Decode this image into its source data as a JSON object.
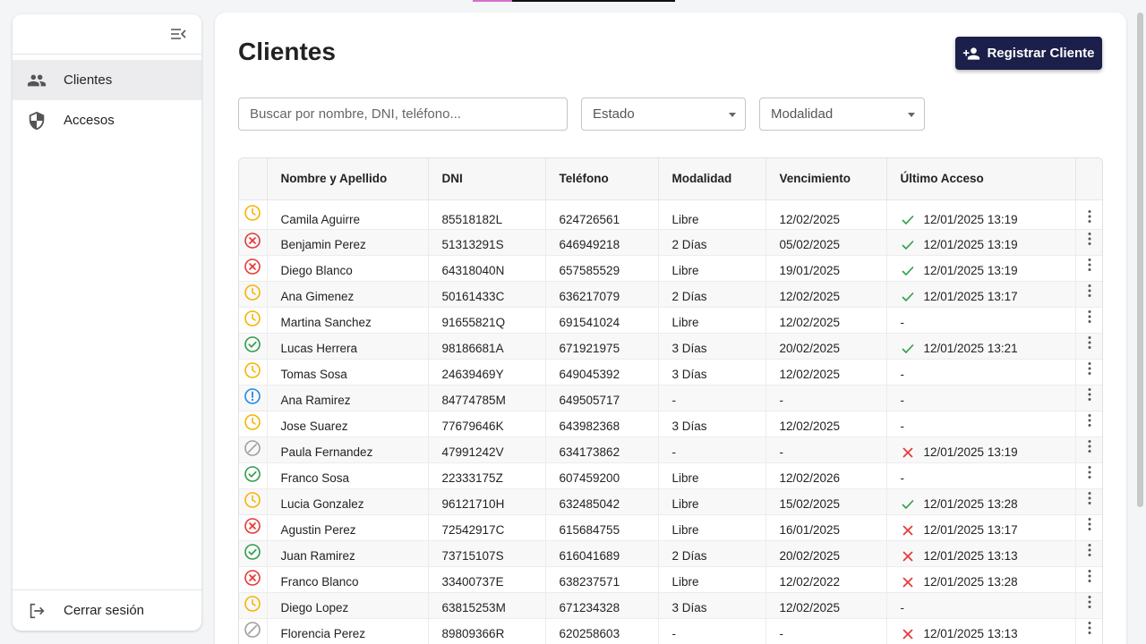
{
  "sidebar": {
    "items": [
      {
        "label": "Clientes",
        "icon": "people-icon",
        "active": true
      },
      {
        "label": "Accesos",
        "icon": "shield-icon",
        "active": false
      }
    ],
    "logout_label": "Cerrar sesión"
  },
  "header": {
    "title": "Clientes",
    "register_label": "Registrar Cliente"
  },
  "filters": {
    "search_placeholder": "Buscar por nombre, DNI, teléfono...",
    "estado_label": "Estado",
    "modalidad_label": "Modalidad"
  },
  "colors": {
    "brand": "#1c1f4a",
    "pending": "#f5b400",
    "expired": "#e53935",
    "active": "#2e9d4a",
    "warning": "#1e88e5",
    "inactive": "#9e9e9e"
  },
  "table": {
    "columns": [
      "Nombre y Apellido",
      "DNI",
      "Teléfono",
      "Modalidad",
      "Vencimiento",
      "Último Acceso"
    ],
    "rows": [
      {
        "status": "pending",
        "name": "Camila Aguirre",
        "dni": "85518182L",
        "phone": "624726561",
        "mode": "Libre",
        "due": "12/02/2025",
        "access_ok": true,
        "access": "12/01/2025 13:19"
      },
      {
        "status": "expired",
        "name": "Benjamin Perez",
        "dni": "51313291S",
        "phone": "646949218",
        "mode": "2 Días",
        "due": "05/02/2025",
        "access_ok": true,
        "access": "12/01/2025 13:19"
      },
      {
        "status": "expired",
        "name": "Diego Blanco",
        "dni": "64318040N",
        "phone": "657585529",
        "mode": "Libre",
        "due": "19/01/2025",
        "access_ok": true,
        "access": "12/01/2025 13:19"
      },
      {
        "status": "pending",
        "name": "Ana Gimenez",
        "dni": "50161433C",
        "phone": "636217079",
        "mode": "2 Días",
        "due": "12/02/2025",
        "access_ok": true,
        "access": "12/01/2025 13:17"
      },
      {
        "status": "pending",
        "name": "Martina Sanchez",
        "dni": "91655821Q",
        "phone": "691541024",
        "mode": "Libre",
        "due": "12/02/2025",
        "access_ok": null,
        "access": "-"
      },
      {
        "status": "active",
        "name": "Lucas Herrera",
        "dni": "98186681A",
        "phone": "671921975",
        "mode": "3 Días",
        "due": "20/02/2025",
        "access_ok": true,
        "access": "12/01/2025 13:21"
      },
      {
        "status": "pending",
        "name": "Tomas Sosa",
        "dni": "24639469Y",
        "phone": "649045392",
        "mode": "3 Días",
        "due": "12/02/2025",
        "access_ok": null,
        "access": "-"
      },
      {
        "status": "warning",
        "name": "Ana Ramirez",
        "dni": "84774785M",
        "phone": "649505717",
        "mode": "-",
        "due": "-",
        "access_ok": null,
        "access": "-"
      },
      {
        "status": "pending",
        "name": "Jose Suarez",
        "dni": "77679646K",
        "phone": "643982368",
        "mode": "3 Días",
        "due": "12/02/2025",
        "access_ok": null,
        "access": "-"
      },
      {
        "status": "inactive",
        "name": "Paula Fernandez",
        "dni": "47991242V",
        "phone": "634173862",
        "mode": "-",
        "due": "-",
        "access_ok": false,
        "access": "12/01/2025 13:19"
      },
      {
        "status": "active",
        "name": "Franco Sosa",
        "dni": "22333175Z",
        "phone": "607459200",
        "mode": "Libre",
        "due": "12/02/2026",
        "access_ok": null,
        "access": "-"
      },
      {
        "status": "pending",
        "name": "Lucia Gonzalez",
        "dni": "96121710H",
        "phone": "632485042",
        "mode": "Libre",
        "due": "15/02/2025",
        "access_ok": true,
        "access": "12/01/2025 13:28"
      },
      {
        "status": "expired",
        "name": "Agustin Perez",
        "dni": "72542917C",
        "phone": "615684755",
        "mode": "Libre",
        "due": "16/01/2025",
        "access_ok": false,
        "access": "12/01/2025 13:17"
      },
      {
        "status": "active",
        "name": "Juan Ramirez",
        "dni": "73715107S",
        "phone": "616041689",
        "mode": "2 Días",
        "due": "20/02/2025",
        "access_ok": false,
        "access": "12/01/2025 13:13"
      },
      {
        "status": "expired",
        "name": "Franco Blanco",
        "dni": "33400737E",
        "phone": "638237571",
        "mode": "Libre",
        "due": "12/02/2022",
        "access_ok": false,
        "access": "12/01/2025 13:28"
      },
      {
        "status": "pending",
        "name": "Diego Lopez",
        "dni": "63815253M",
        "phone": "671234328",
        "mode": "3 Días",
        "due": "12/02/2025",
        "access_ok": null,
        "access": "-"
      },
      {
        "status": "inactive",
        "name": "Florencia Perez",
        "dni": "89809366R",
        "phone": "620258603",
        "mode": "-",
        "due": "-",
        "access_ok": false,
        "access": "12/01/2025 13:13"
      }
    ]
  }
}
